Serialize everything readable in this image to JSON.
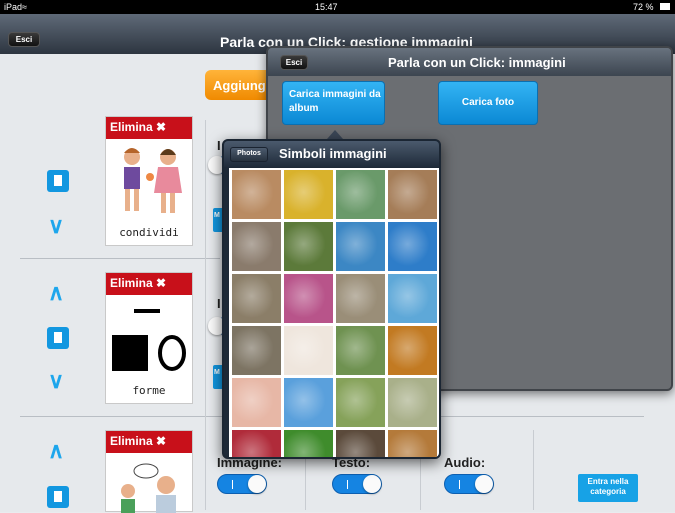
{
  "status": {
    "device": "iPad",
    "time": "15:47",
    "battery": "72 %"
  },
  "main_nav": {
    "exit_label": "Esci",
    "title": "Parla con un Click: gestione immagini"
  },
  "toolbar": {
    "add_label": "Aggiungi"
  },
  "rows": [
    {
      "delete_label": "Elimina",
      "caption": "condividi"
    },
    {
      "delete_label": "Elimina",
      "caption": "forme"
    },
    {
      "delete_label": "Elimina",
      "caption": ""
    }
  ],
  "side_buttons": [
    "M",
    "M"
  ],
  "fields": {
    "image_label": "Immagine:",
    "text_label": "Testo:",
    "audio_label": "Audio:"
  },
  "enter_category_label": "Entra nella categoria",
  "images_popover": {
    "exit_label": "Esci",
    "title": "Parla con un Click: immagini",
    "load_album_label": "Carica immagini da album",
    "load_photo_label": "Carica foto"
  },
  "symbols_popover": {
    "back_label": "Photos",
    "title": "Simboli immagini",
    "thumbnails": [
      {
        "name": "kitchen-photo",
        "color": "#b98b62"
      },
      {
        "name": "bananas-photo",
        "color": "#d9b22c"
      },
      {
        "name": "bottle-photo",
        "color": "#6a9a6a"
      },
      {
        "name": "living-room-photo",
        "color": "#a57d58"
      },
      {
        "name": "office-photo",
        "color": "#8a7b6c"
      },
      {
        "name": "duck-photo",
        "color": "#5c7a3a"
      },
      {
        "name": "dolphin-photo",
        "color": "#3c87c4"
      },
      {
        "name": "dolphin-jump-photo",
        "color": "#2e7dc9"
      },
      {
        "name": "elephant-photo",
        "color": "#8b7e68"
      },
      {
        "name": "butterfly-photo",
        "color": "#b8548a"
      },
      {
        "name": "cat-photo",
        "color": "#9a8e78"
      },
      {
        "name": "resort-photo",
        "color": "#5ea8d8"
      },
      {
        "name": "hippo-photo",
        "color": "#7d7463"
      },
      {
        "name": "clown-photo",
        "color": "#efe6dd"
      },
      {
        "name": "koala-photo",
        "color": "#6f9251"
      },
      {
        "name": "lion-photo",
        "color": "#c27a22"
      },
      {
        "name": "pig-photo",
        "color": "#e7b7a6"
      },
      {
        "name": "clouds-photo",
        "color": "#5aa0dc"
      },
      {
        "name": "goose-photo",
        "color": "#86a25a"
      },
      {
        "name": "sheep-photo",
        "color": "#a9b08a"
      },
      {
        "name": "flowers-photo",
        "color": "#b02b3a"
      },
      {
        "name": "frog-photo",
        "color": "#3f8c2c"
      },
      {
        "name": "chimp-photo",
        "color": "#5b4a3b"
      },
      {
        "name": "tiger-photo",
        "color": "#b47a3a"
      }
    ]
  }
}
